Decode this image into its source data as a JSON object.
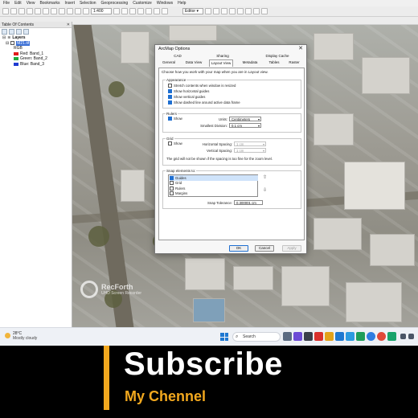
{
  "menu": [
    "File",
    "Edit",
    "View",
    "Bookmarks",
    "Insert",
    "Selection",
    "Geoprocessing",
    "Customize",
    "Windows",
    "Help"
  ],
  "toolbar": {
    "scale": "1:400",
    "editor": "Editor ▾"
  },
  "toc": {
    "title": "Table Of Contents",
    "close": "✕",
    "layers_label": "Layers",
    "raster_name": "M21.tif",
    "rgb_label": "RGB",
    "bands": [
      {
        "label": "Red:   Band_1",
        "color": "#e21b1b"
      },
      {
        "label": "Green: Band_2",
        "color": "#1faa3a"
      },
      {
        "label": "Blue:  Band_3",
        "color": "#1f3bd1"
      }
    ]
  },
  "watermark": {
    "title": "RecForth",
    "subtitle": "UHD Screen Recorder"
  },
  "dialog": {
    "title": "ArcMap Options",
    "close": "✕",
    "tabs_row1": [
      "CAD",
      "Sharing",
      "Display Cache"
    ],
    "tabs_row2": [
      "General",
      "Data View",
      "Layout View",
      "Metadata",
      "Tables",
      "Raster"
    ],
    "intro": "Choose how you work with your map when you are in Layout view.",
    "appearance": {
      "label": "Appearance",
      "options": [
        {
          "label": "Stretch contents when window is resized",
          "checked": false
        },
        {
          "label": "Show horizontal guides",
          "checked": true
        },
        {
          "label": "Show vertical guides",
          "checked": true
        },
        {
          "label": "Show dashed line around active data frame",
          "checked": true
        }
      ]
    },
    "rulers": {
      "label": "Rulers",
      "show": "Show",
      "units_label": "Units:",
      "units_value": "Centimeters",
      "division_label": "Smallest Division:",
      "division_value": "0.1 cm"
    },
    "grid": {
      "label": "Grid",
      "show": "Show",
      "hspacing_label": "Horizontal Spacing:",
      "hspacing_value": "1 cm",
      "vspacing_label": "Vertical Spacing:",
      "vspacing_value": "1 cm",
      "note": "The grid will not be shown if the spacing is too fine for the zoom level."
    },
    "snap": {
      "label": "Snap elements to:",
      "items": [
        {
          "label": "Guides",
          "checked": true
        },
        {
          "label": "Grid",
          "checked": false
        },
        {
          "label": "Rulers",
          "checked": false
        },
        {
          "label": "Margins",
          "checked": false
        }
      ],
      "up": "⇧",
      "down": "⇩",
      "tolerance_label": "Snap Tolerance:",
      "tolerance_value": "0.300001 cm"
    },
    "buttons": {
      "ok": "OK",
      "cancel": "Cancel",
      "apply": "Apply"
    }
  },
  "taskbar": {
    "temp": "28°C",
    "weather": "Mostly cloudy",
    "search": "Search"
  },
  "banner": {
    "title": "Subscribe",
    "channel": "My Chennel",
    "accent": "#f2a81e"
  }
}
